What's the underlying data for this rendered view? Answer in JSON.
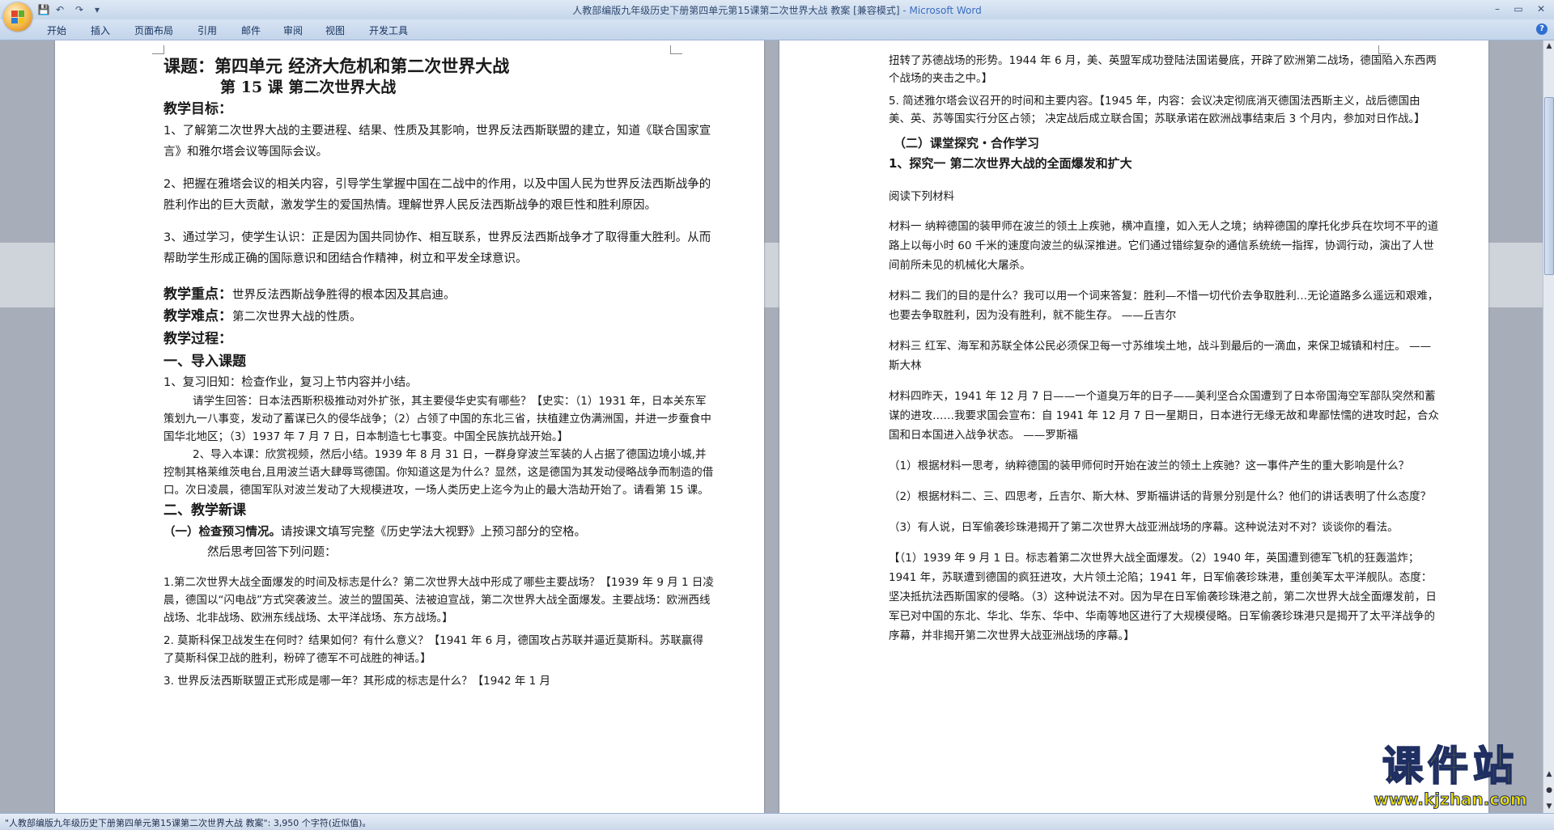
{
  "window": {
    "title": "人教部编版九年级历史下册第四单元第15课第二次世界大战 教案 [兼容模式]",
    "app_suffix": " - Microsoft Word",
    "controls": [
      "–",
      "▭",
      "✕"
    ]
  },
  "qat": {
    "save": "💾",
    "undo": "↶",
    "redo": "↷",
    "customize": "▾"
  },
  "ribbon": {
    "tabs": [
      "开始",
      "插入",
      "页面布局",
      "引用",
      "邮件",
      "审阅",
      "视图",
      "开发工具"
    ],
    "help": "?"
  },
  "left_page": {
    "title": "课题：第四单元 经济大危机和第二次世界大战",
    "subtitle": "第 15 课   第二次世界大战",
    "goals_heading": "教学目标：",
    "goal1": "1、了解第二次世界大战的主要进程、结果、性质及其影响，世界反法西斯联盟的建立，知道《联合国家宣言》和雅尔塔会议等国际会议。",
    "goal2": "2、把握在雅塔会议的相关内容，引导学生掌握中国在二战中的作用，以及中国人民为世界反法西斯战争的胜利作出的巨大贡献，激发学生的爱国热情。理解世界人民反法西斯战争的艰巨性和胜利原因。",
    "goal3": "3、通过学习，使学生认识：正是因为国共同协作、相互联系，世界反法西斯战争才了取得重大胜利。从而帮助学生形成正确的国际意识和团结合作精神，树立和平发全球意识。",
    "key_label": "教学重点：",
    "key_text": "世界反法西斯战争胜得的根本因及其启迪。",
    "diff_label": "教学难点：",
    "diff_text": "第二次世界大战的性质。",
    "process_label": "教学过程：",
    "intro_heading": "一、导入课题",
    "review": "1、复习旧知：检查作业，复习上节内容并小结。",
    "review_q": "请学生回答：日本法西斯积极推动对外扩张，其主要侵华史实有哪些？【史实：（1）1931 年，日本关东军策划九一八事变，发动了蓄谋已久的侵华战争；（2）占领了中国的东北三省，扶植建立伪满洲国，并进一步蚕食中国华北地区；（3）1937 年 7 月 7 日，日本制造七七事变。中国全民族抗战开始。】",
    "intro_new": "2、导入本课：欣赏视频，然后小结。1939 年 8 月 31 日，一群身穿波兰军装的人占据了德国边境小城,并控制其格莱维茨电台,且用波兰语大肆辱骂德国。你知道这是为什么？显然，这是德国为其发动侵略战争而制造的借口。次日凌晨，德国军队对波兰发动了大规模进攻，一场人类历史上迄今为止的最大浩劫开始了。请看第 15 课。",
    "new_heading": "二、教学新课",
    "preview_label": "（一）检查预习情况。",
    "preview_text": "请按课文填写完整《历史学法大视野》上预习部分的空格。",
    "preview_text2": "然后思考回答下列问题：",
    "q1": "1.第二次世界大战全面爆发的时间及标志是什么？第二次世界大战中形成了哪些主要战场？【1939 年 9 月 1 日凌晨，德国以“闪电战”方式突袭波兰。波兰的盟国英、法被迫宣战，第二次世界大战全面爆发。主要战场：欧洲西线战场、北非战场、欧洲东线战场、太平洋战场、东方战场。】",
    "q2": "2. 莫斯科保卫战发生在何时？结果如何？有什么意义？【1941 年 6 月，德国攻占苏联并逼近莫斯科。苏联赢得了莫斯科保卫战的胜利，粉碎了德军不可战胜的神话。】",
    "q3": "3. 世界反法西斯联盟正式形成是哪一年？其形成的标志是什么？【1942 年 1 月"
  },
  "right_page": {
    "cont": "扭转了苏德战场的形势。1944 年 6 月，美、英盟军成功登陆法国诺曼底，开辟了欧洲第二战场，德国陷入东西两个战场的夹击之中。】",
    "q5": "5. 简述雅尔塔会议召开的时间和主要内容。【1945 年，内容：会议决定彻底消灭德国法西斯主义，战后德国由美、英、苏等国实行分区占领； 决定战后成立联合国；苏联承诺在欧洲战事结束后 3 个月内，参加对日作战。】",
    "explore_heading": "（二）课堂探究・合作学习",
    "explore1": "1、探究一   第二次世界大战的全面爆发和扩大",
    "read": "阅读下列材料",
    "m1": "材料一  纳粹德国的装甲师在波兰的领土上疾驰，横冲直撞，如入无人之境；纳粹德国的摩托化步兵在坎坷不平的道路上以每小时 60 千米的速度向波兰的纵深推进。它们通过错综复杂的通信系统统一指挥，协调行动，演出了人世间前所未见的机械化大屠杀。",
    "m2": "材料二  我们的目的是什么？我可以用一个词来答复：胜利—不惜一切代价去争取胜利…无论道路多么遥远和艰难，也要去争取胜利，因为没有胜利，就不能生存。    ——丘吉尔",
    "m3": "材料三  红军、海军和苏联全体公民必须保卫每一寸苏维埃土地，战斗到最后的一滴血，来保卫城镇和村庄。                   ——斯大林",
    "m4": "材料四昨天，1941 年 12 月 7 日——一个道臭万年的日子——美利坚合众国遭到了日本帝国海空军部队突然和蓄谋的进攻……我要求国会宣布：自 1941 年 12 月 7 日一星期日，日本进行无缘无故和卑鄙怯懦的进攻时起，合众国和日本国进入战争状态。       ——罗斯福",
    "t1": "（1）根据材料一思考，纳粹德国的装甲师何时开始在波兰的领土上疾驰？这一事件产生的重大影响是什么？",
    "t2": "（2）根据材料二、三、四思考，丘吉尔、斯大林、罗斯福讲话的背景分别是什么？他们的讲话表明了什么态度？",
    "t3": "（3）有人说，日军偷袭珍珠港揭开了第二次世界大战亚洲战场的序幕。这种说法对不对？谈谈你的看法。",
    "ans": "【（1）1939 年 9 月 1 日。标志着第二次世界大战全面爆发。（2）1940 年，英国遭到德军飞机的狂轰滥炸；1941 年，苏联遭到德国的疯狂进攻，大片领土沦陷；1941 年，日军偷袭珍珠港，重创美军太平洋舰队。态度：坚决抵抗法西斯国家的侵略。（3）这种说法不对。因为早在日军偷袭珍珠港之前，第二次世界大战全面爆发前，日军已对中国的东北、华北、华东、华中、华南等地区进行了大规模侵略。日军偷袭珍珠港只是揭开了太平洋战争的序幕，并非揭开第二次世界大战亚洲战场的序幕。】"
  },
  "status": {
    "text": "\"人教部编版九年级历史下册第四单元第15课第二次世界大战 教案\": 3,950 个字符(近似值)。"
  },
  "watermark": {
    "cn": "课件站",
    "url": "www.kjzhan.com"
  }
}
